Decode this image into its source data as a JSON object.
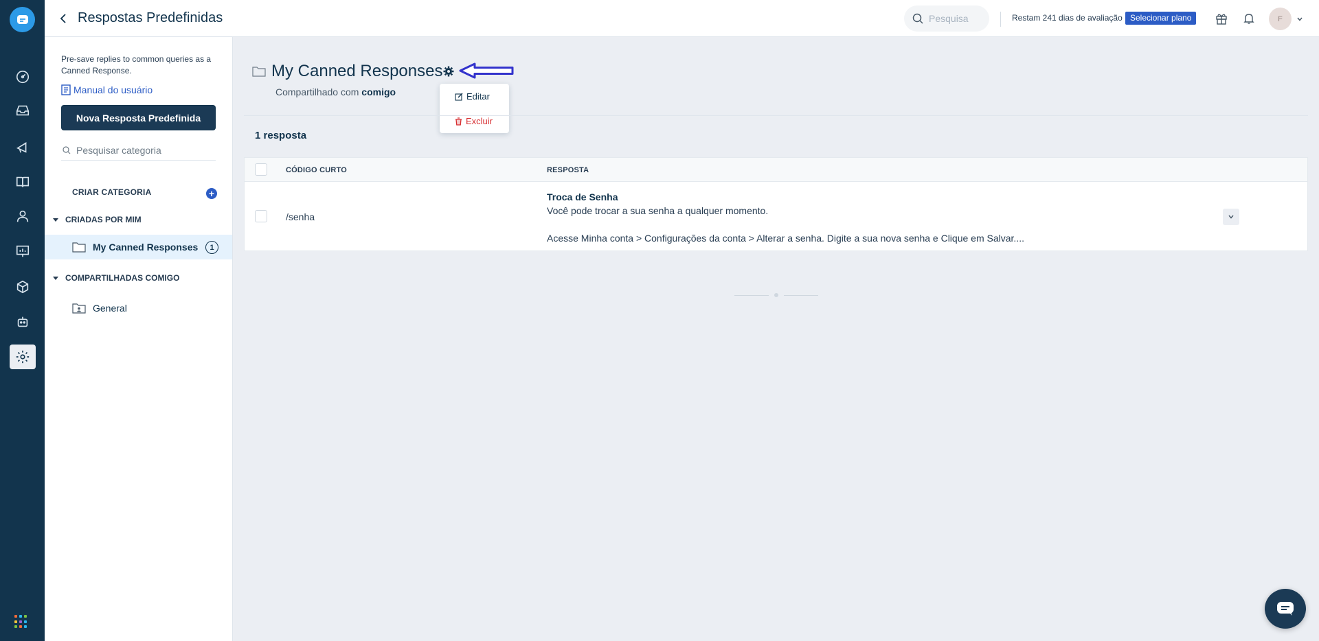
{
  "header": {
    "title": "Respostas Predefinidas",
    "search_placeholder": "Pesquisa",
    "trial_text": "Restam 241 dias de avaliação",
    "plan_button": "Selecionar plano",
    "avatar_initial": "F"
  },
  "rail": {
    "items": [
      "dashboard-icon",
      "inbox-icon",
      "campaigns-icon",
      "knowledge-base-icon",
      "contacts-icon",
      "analytics-icon",
      "products-icon",
      "bot-icon",
      "settings-icon"
    ],
    "active": "settings-icon",
    "apps_colors": [
      "#f36b39",
      "#2ab7ef",
      "#7cc142",
      "#f5c33b",
      "#9a63d0",
      "#2ab7ef",
      "#7cc142",
      "#f36b39",
      "#2ab7ef"
    ]
  },
  "sidebar": {
    "description": "Pre-save replies to common queries as a Canned Response.",
    "manual_link": "Manual do usuário",
    "new_button": "Nova Resposta Predefinida",
    "category_search_placeholder": "Pesquisar categoria",
    "create_category": "CRIAR CATEGORIA",
    "groups": [
      {
        "label": "CRIADAS POR MIM",
        "items": [
          {
            "label": "My Canned Responses",
            "count": "1",
            "active": true
          }
        ]
      },
      {
        "label": "COMPARTILHADAS COMIGO",
        "items": [
          {
            "label": "General"
          }
        ]
      }
    ]
  },
  "main": {
    "folder_title": "My Canned Responses",
    "shared_prefix": "Compartilhado com",
    "shared_with": "comigo",
    "menu": {
      "edit": "Editar",
      "delete": "Excluir"
    },
    "count_label": "1 resposta",
    "table": {
      "columns": [
        "CÓDIGO CURTO",
        "RESPOSTA"
      ],
      "rows": [
        {
          "code": "/senha",
          "title": "Troca de Senha",
          "line1": "Você pode trocar a sua senha a qualquer momento.",
          "line2": "Acesse Minha conta > Configurações da conta > Alterar a senha. Digite a sua nova senha e Clique em Salvar...."
        }
      ]
    }
  },
  "colors": {
    "rail_bg": "#12344d",
    "accent": "#2c5cc5",
    "danger": "#d72d30",
    "annotation_arrow": "#3333cc"
  }
}
